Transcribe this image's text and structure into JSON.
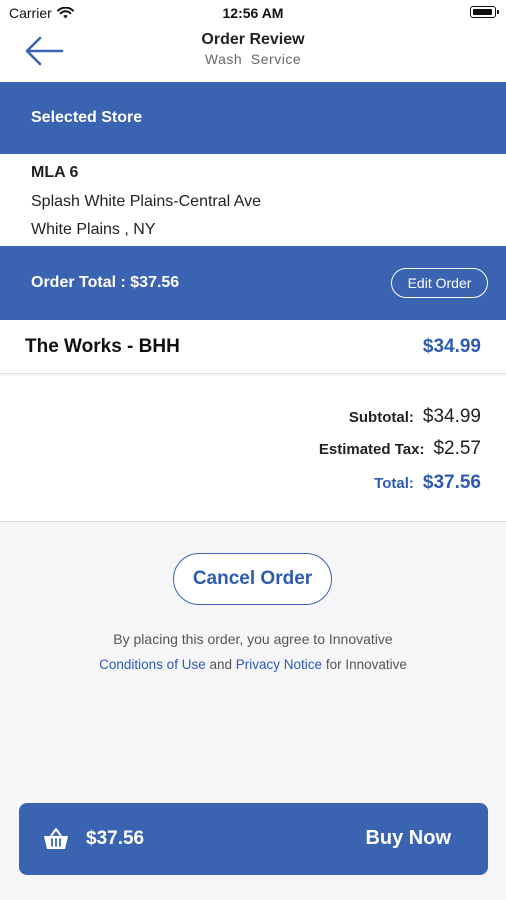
{
  "status_bar": {
    "carrier": "Carrier",
    "time": "12:56 AM"
  },
  "nav": {
    "title": "Order Review",
    "subtitle": "Wash  Service"
  },
  "store": {
    "header": "Selected Store",
    "name": "MLA 6",
    "address": "Splash White Plains-Central Ave",
    "city": "White Plains , NY"
  },
  "order": {
    "total_label": "Order Total : $37.56",
    "edit_label": "Edit Order"
  },
  "item": {
    "name": "The Works - BHH",
    "price": "$34.99"
  },
  "summary": {
    "subtotal_label": "Subtotal:",
    "subtotal": "$34.99",
    "tax_label": "Estimated Tax:",
    "tax": "$2.57",
    "total_label": "Total:",
    "total": "$37.56"
  },
  "cancel_label": "Cancel Order",
  "agreement": {
    "text": "By placing this order, you agree to Innovative",
    "conditions_link": "Conditions of Use",
    "and": "and",
    "privacy_link": "Privacy Notice",
    "suffix": "for Innovative"
  },
  "buy": {
    "amount": "$37.56",
    "label": "Buy Now"
  },
  "colors": {
    "primary": "#3a63b1",
    "accent_text": "#2d5bb2",
    "background": "#f6f6f8"
  }
}
